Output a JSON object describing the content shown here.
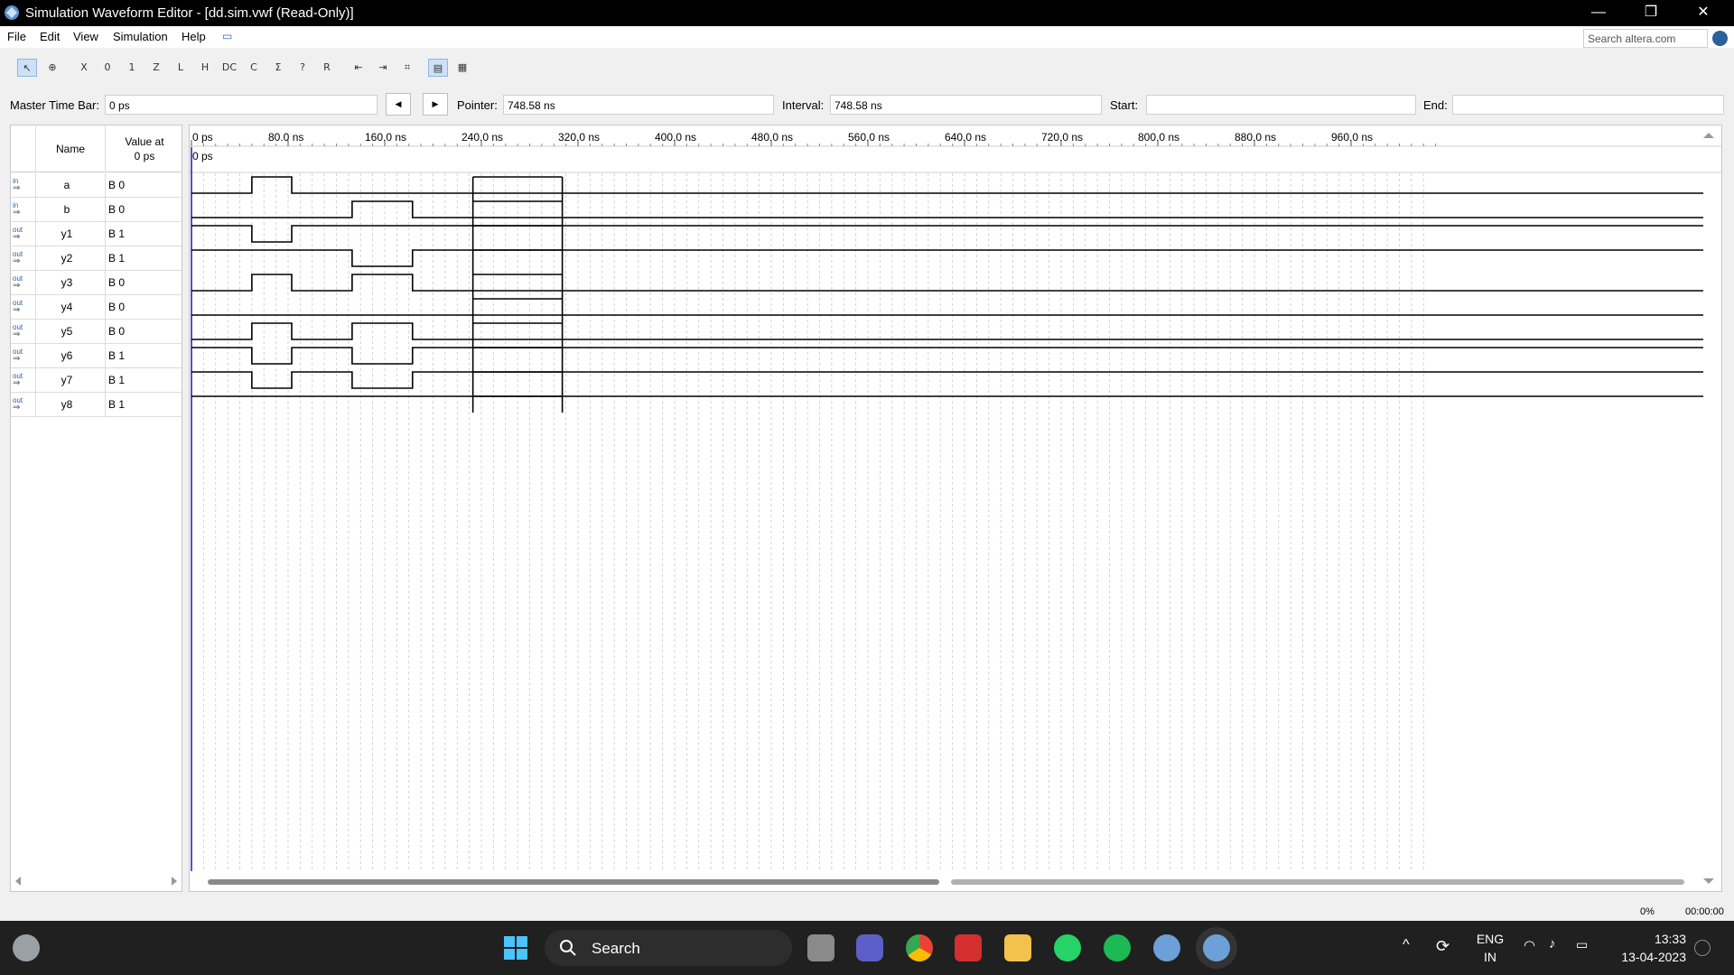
{
  "window": {
    "title": "Simulation Waveform Editor - [dd.sim.vwf (Read-Only)]"
  },
  "menu": [
    "File",
    "Edit",
    "View",
    "Simulation",
    "Help"
  ],
  "search": {
    "placeholder": "Search altera.com"
  },
  "timebar": {
    "master_label": "Master Time Bar:",
    "master_value": "0 ps",
    "pointer_label": "Pointer:",
    "pointer_value": "748.58 ns",
    "interval_label": "Interval:",
    "interval_value": "748.58 ns",
    "start_label": "Start:",
    "start_value": "",
    "end_label": "End:",
    "end_value": ""
  },
  "signal_table": {
    "name_header": "Name",
    "value_header_line1": "Value at",
    "value_header_line2": "0 ps",
    "signals": [
      {
        "direction": "in",
        "name": "a",
        "value": "B 0",
        "transitions_ns": [
          50,
          83
        ]
      },
      {
        "direction": "in",
        "name": "b",
        "value": "B 0",
        "transitions_ns": [
          133,
          183
        ]
      },
      {
        "direction": "out",
        "name": "y1",
        "value": "B 1",
        "transitions_ns": [
          50,
          83
        ]
      },
      {
        "direction": "out",
        "name": "y2",
        "value": "B 1",
        "transitions_ns": [
          133,
          183
        ]
      },
      {
        "direction": "out",
        "name": "y3",
        "value": "B 0",
        "transitions_ns": [
          50,
          83,
          133,
          183
        ]
      },
      {
        "direction": "out",
        "name": "y4",
        "value": "B 0",
        "transitions_ns": []
      },
      {
        "direction": "out",
        "name": "y5",
        "value": "B 0",
        "transitions_ns": [
          50,
          83,
          133,
          183
        ]
      },
      {
        "direction": "out",
        "name": "y6",
        "value": "B 1",
        "transitions_ns": [
          50,
          83,
          133,
          183
        ]
      },
      {
        "direction": "out",
        "name": "y7",
        "value": "B 1",
        "transitions_ns": [
          50,
          83,
          133,
          183
        ]
      },
      {
        "direction": "out",
        "name": "y8",
        "value": "B 1",
        "transitions_ns": []
      }
    ],
    "bus_overlay_ns": [
      233,
      307
    ]
  },
  "timeline": {
    "ticks": [
      "0 ps",
      "80.0 ns",
      "160.0 ns",
      "240.0 ns",
      "320.0 ns",
      "400.0 ns",
      "480.0 ns",
      "560.0 ns",
      "640.0 ns",
      "720.0 ns",
      "800.0 ns",
      "880.0 ns",
      "960.0 ns"
    ],
    "master_marker": "0 ps",
    "range_ns": [
      0,
      1000
    ]
  },
  "status": {
    "progress": "0%",
    "elapsed": "00:00:00"
  },
  "taskbar": {
    "search_label": "Search",
    "lang_line1": "ENG",
    "lang_line2": "IN",
    "time": "13:33",
    "date": "13-04-2023"
  }
}
